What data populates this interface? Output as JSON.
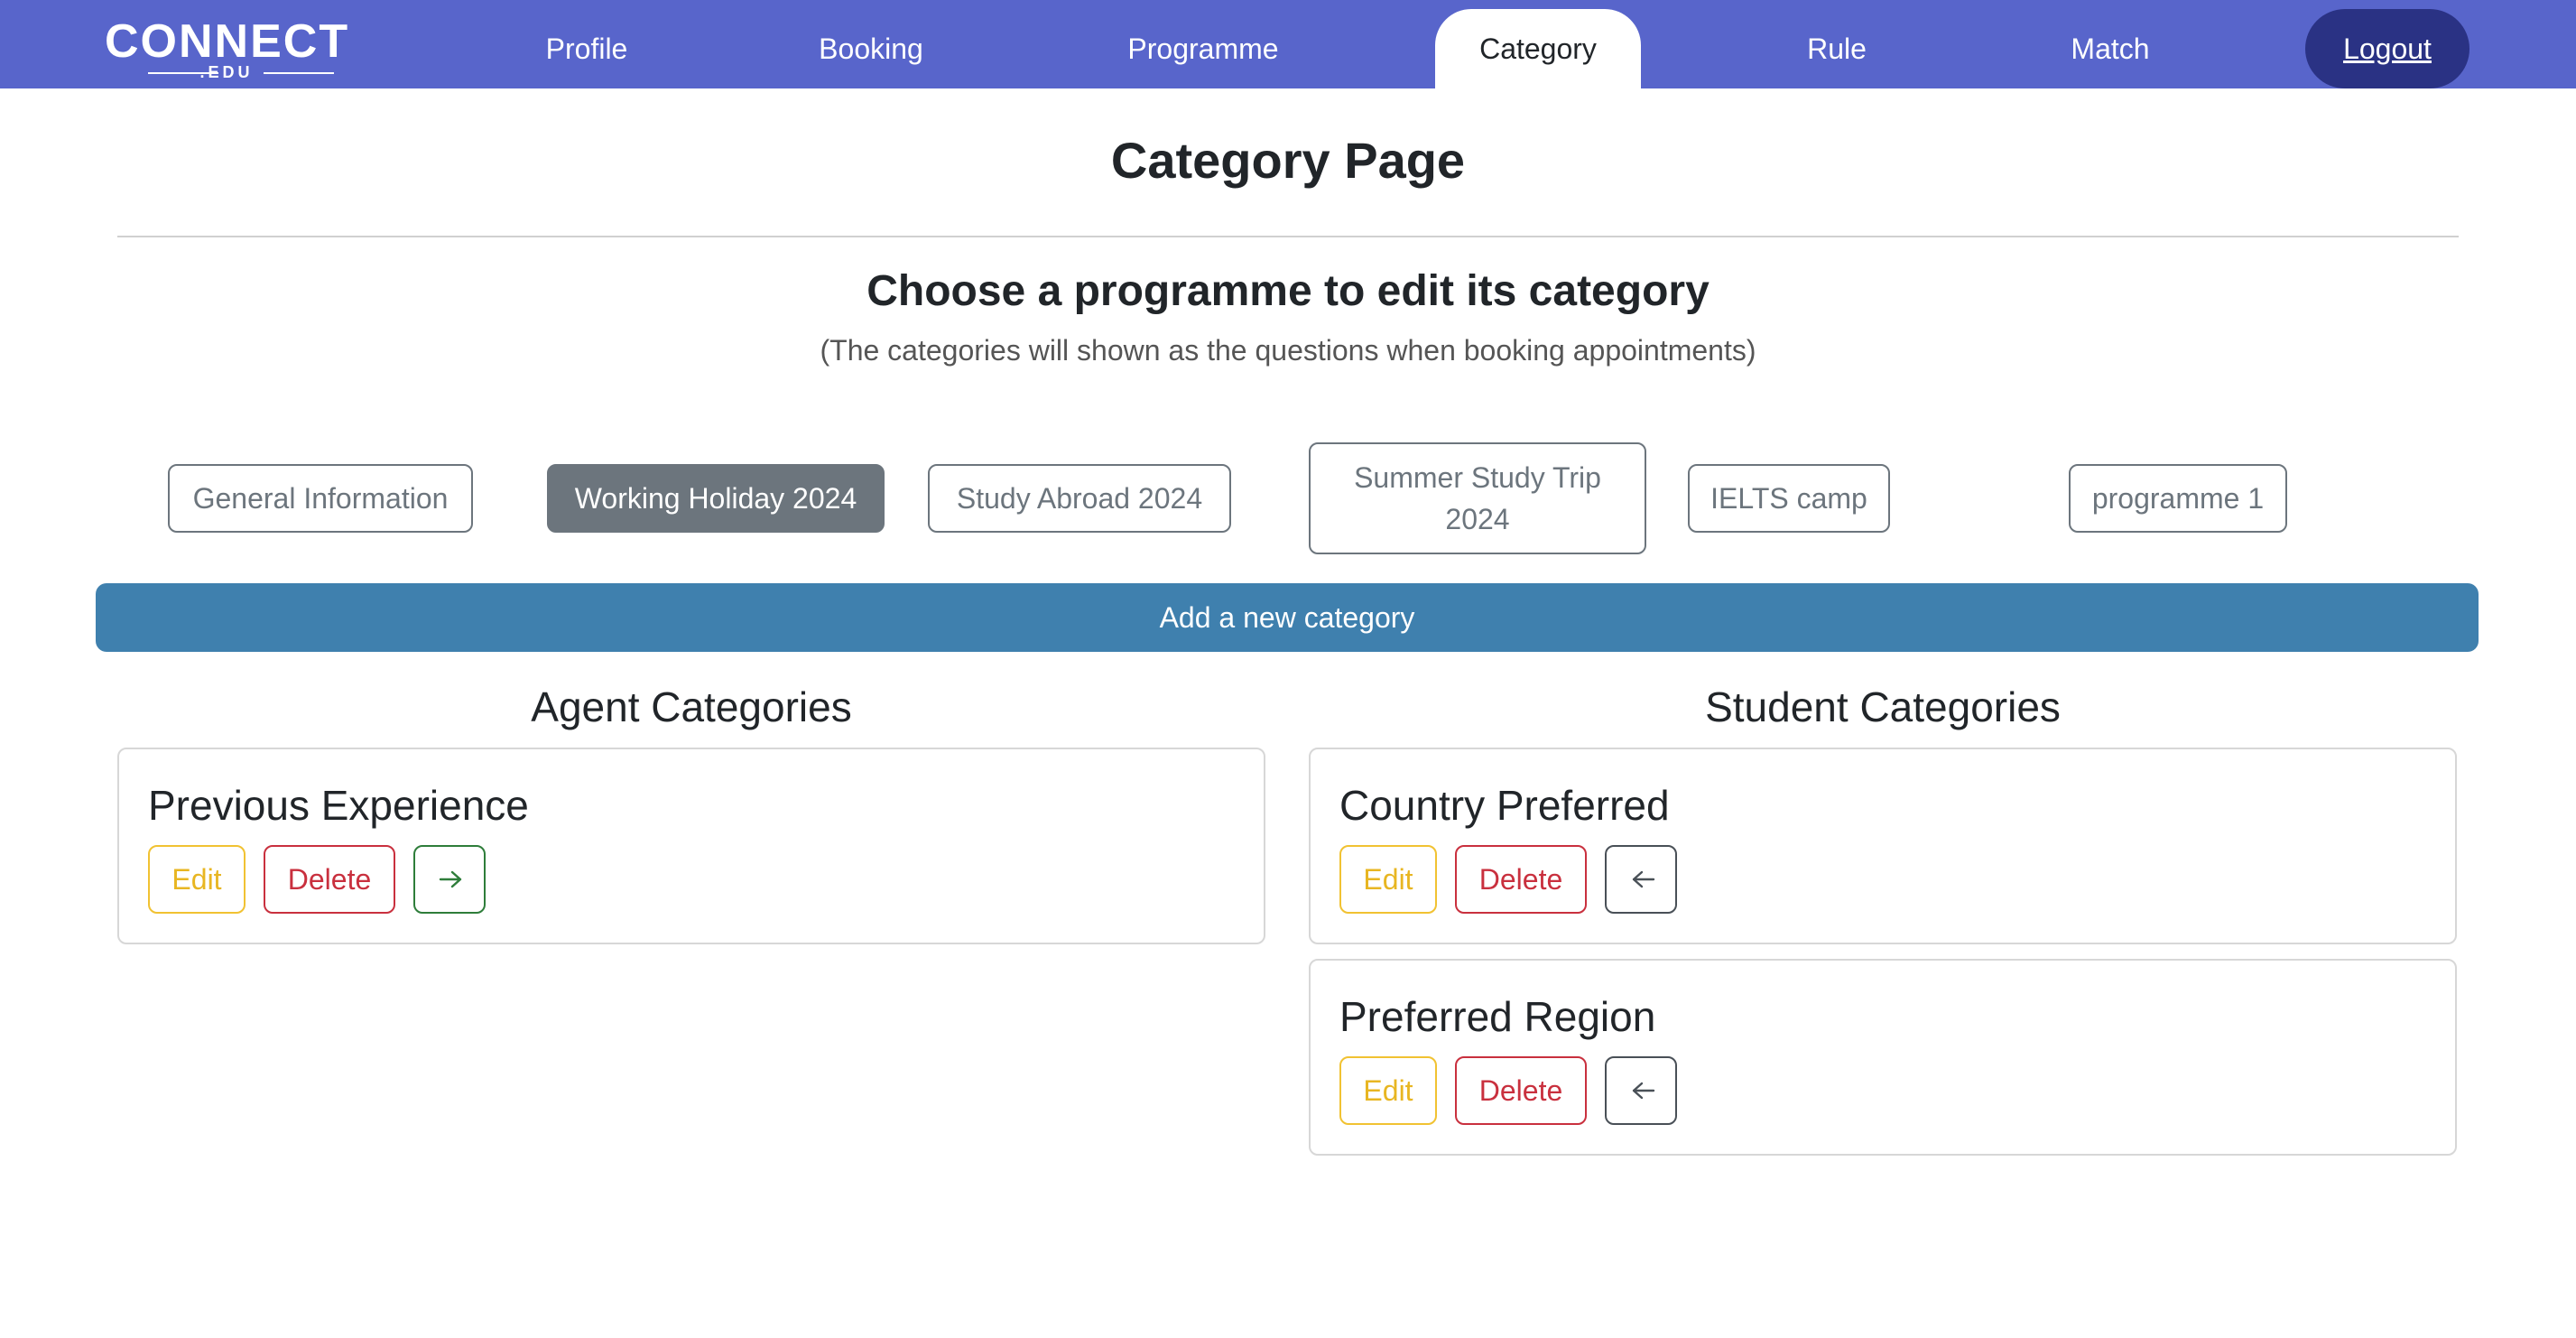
{
  "nav": {
    "logo_main": "CONNECT",
    "logo_sub": ".EDU",
    "items": [
      {
        "label": "Profile"
      },
      {
        "label": "Booking"
      },
      {
        "label": "Programme"
      },
      {
        "label": "Category"
      },
      {
        "label": "Rule"
      },
      {
        "label": "Match"
      }
    ],
    "active": "Category",
    "logout_label": "Logout"
  },
  "page": {
    "title": "Category Page",
    "subtitle": "Choose a programme to edit its category",
    "note": "(The categories will shown as the questions when booking appointments)"
  },
  "programmes": [
    {
      "label": "General Information",
      "selected": false
    },
    {
      "label": "Working Holiday 2024",
      "selected": true
    },
    {
      "label": "Study Abroad 2024",
      "selected": false
    },
    {
      "label": "Summer Study Trip 2024",
      "selected": false
    },
    {
      "label": "IELTS camp",
      "selected": false
    },
    {
      "label": "programme 1",
      "selected": false
    }
  ],
  "add_category_label": "Add a new category",
  "agent": {
    "heading": "Agent Categories",
    "cards": [
      {
        "title": "Previous Experience",
        "edit": "Edit",
        "delete": "Delete",
        "move_icon": "arrow-right-icon"
      }
    ]
  },
  "student": {
    "heading": "Student Categories",
    "cards": [
      {
        "title": "Country Preferred",
        "edit": "Edit",
        "delete": "Delete",
        "move_icon": "arrow-left-icon"
      },
      {
        "title": "Preferred Region",
        "edit": "Edit",
        "delete": "Delete",
        "move_icon": "arrow-left-icon"
      }
    ]
  },
  "colors": {
    "navbar": "#5865cb",
    "logout": "#2a3284",
    "add_button": "#3f80ae",
    "selected_programme": "#6c757d",
    "edit": "#e8b622",
    "delete": "#c9303e",
    "move_right": "#2e7d3a",
    "move_left": "#495057"
  }
}
